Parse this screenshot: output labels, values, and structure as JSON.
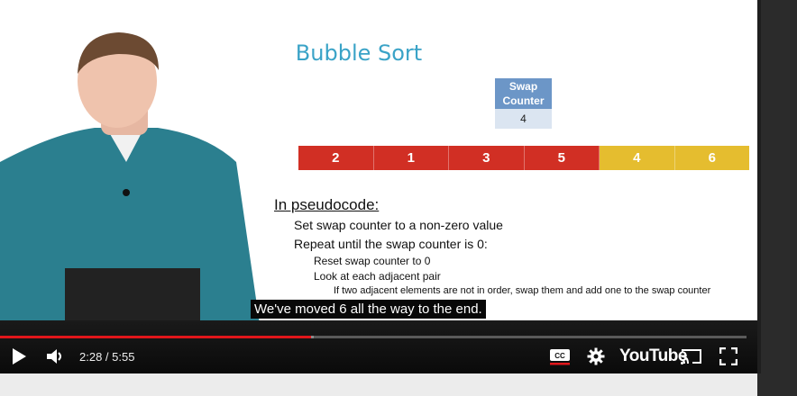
{
  "slide": {
    "title": "Bubble Sort",
    "swap_counter": {
      "label": "Swap\nCounter",
      "value": "4"
    },
    "array": [
      {
        "value": "2",
        "state": "unsorted",
        "color": "#d12f24"
      },
      {
        "value": "1",
        "state": "unsorted",
        "color": "#d12f24"
      },
      {
        "value": "3",
        "state": "unsorted",
        "color": "#d12f24"
      },
      {
        "value": "5",
        "state": "unsorted",
        "color": "#d12f24"
      },
      {
        "value": "4",
        "state": "sorted",
        "color": "#e5bd2f"
      },
      {
        "value": "6",
        "state": "sorted",
        "color": "#e5bd2f"
      }
    ],
    "pseudocode": {
      "heading": "In pseudocode:",
      "line1": "Set swap counter to a non-zero value",
      "line2": "Repeat until the swap counter is 0:",
      "line3": "Reset swap counter to 0",
      "line4": "Look at each adjacent pair",
      "line5": "If two adjacent elements are not in order, swap them and add one to the swap counter"
    }
  },
  "captions": {
    "text": "We've moved 6 all the way to the end."
  },
  "player": {
    "time": "2:28 / 5:55",
    "progress_fraction": 0.417,
    "buffered_fraction": 0.42,
    "cc_label": "CC",
    "logo_text": "YouTube",
    "icons": {
      "play": "play-icon",
      "volume": "volume-icon",
      "cc": "closed-captions-icon",
      "settings": "gear-icon",
      "cast": "cast-icon",
      "fullscreen": "fullscreen-icon"
    },
    "colors": {
      "progress": "#e0161b",
      "cc_underline": "#e0161b"
    }
  }
}
